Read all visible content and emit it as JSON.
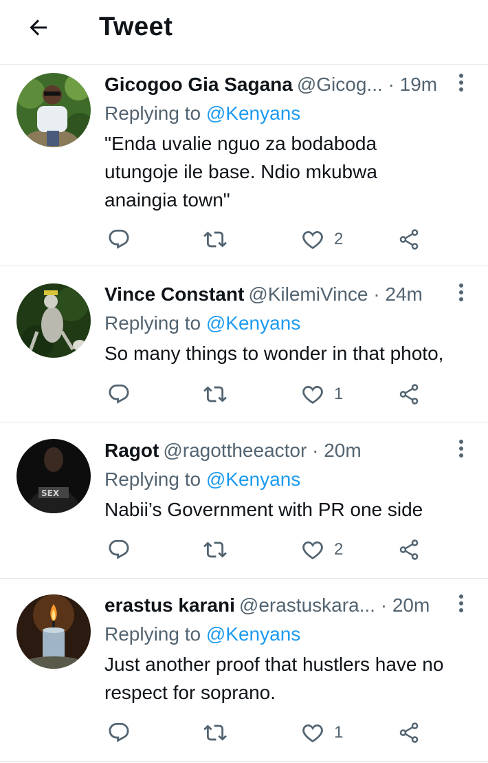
{
  "header": {
    "title": "Tweet",
    "back_icon": "arrow-left-icon"
  },
  "colors": {
    "link": "#1d9bf0",
    "secondary": "#536471",
    "text": "#0f1419",
    "divider": "#e7e9ea"
  },
  "tweets": [
    {
      "name": "Gicogoo Gia Sagana",
      "handle": "@Gicog...",
      "dot": "·",
      "time": "19m",
      "replying_prefix": "Replying to",
      "replying_to": "@Kenyans",
      "text": "\"Enda uvalie nguo za bodaboda utungoje ile base. Ndio mkubwa anaingia town\"",
      "likes": "2"
    },
    {
      "name": "Vince Constant",
      "handle": "@KilemiVince",
      "dot": "·",
      "time": "24m",
      "replying_prefix": "Replying to",
      "replying_to": "@Kenyans",
      "text": "So many things to wonder in that photo,",
      "likes": "1"
    },
    {
      "name": "Ragot",
      "handle": "@ragottheeactor",
      "dot": "·",
      "time": "20m",
      "replying_prefix": "Replying to",
      "replying_to": "@Kenyans",
      "text": "Nabii’s Government with PR one side",
      "likes": "2"
    },
    {
      "name": "erastus karani",
      "handle": "@erastuskara...",
      "dot": "·",
      "time": "20m",
      "replying_prefix": "Replying to",
      "replying_to": "@Kenyans",
      "text": "Just another proof that hustlers have no respect for soprano.",
      "likes": "1"
    }
  ]
}
